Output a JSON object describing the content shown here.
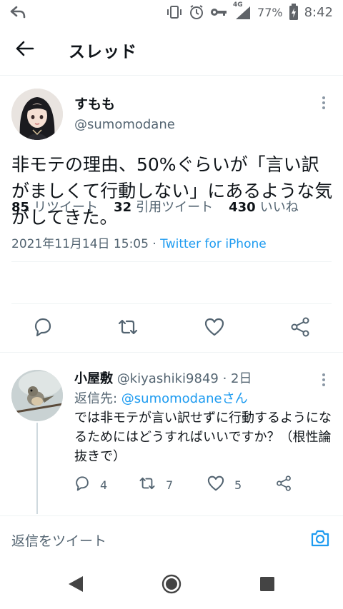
{
  "status_bar": {
    "network": "4G",
    "battery": "77%",
    "time": "8:42"
  },
  "header": {
    "title": "スレッド"
  },
  "tweet": {
    "author_name": "すもも",
    "author_handle": "@sumomodane",
    "text": "非モテの理由、50%ぐらいが「言い訳がましくて行動しない」にあるような気がしてきた。",
    "datetime": "2021年11月14日 15:05",
    "separator": " · ",
    "source": "Twitter for iPhone",
    "stats": [
      {
        "count": "85",
        "label": "リツイート"
      },
      {
        "count": "32",
        "label": "引用ツイート"
      },
      {
        "count": "430",
        "label": "いいね"
      }
    ]
  },
  "reply": {
    "author_name": "小屋敷",
    "author_handle": "@kiyashiki9849",
    "time": "· 2日",
    "reply_to_prefix": "返信先: ",
    "reply_to_mention": "@sumomodane",
    "reply_to_suffix": "さん",
    "text": "では非モテが言い訳せずに行動するようになるためにはどうすればいいですか？（根性論抜きで）",
    "reply_count": "4",
    "retweet_count": "7",
    "like_count": "5"
  },
  "composer": {
    "placeholder": "返信をツイート"
  },
  "colors": {
    "accent": "#1d9bf0",
    "text": "#0f1419",
    "secondary": "#536471"
  }
}
